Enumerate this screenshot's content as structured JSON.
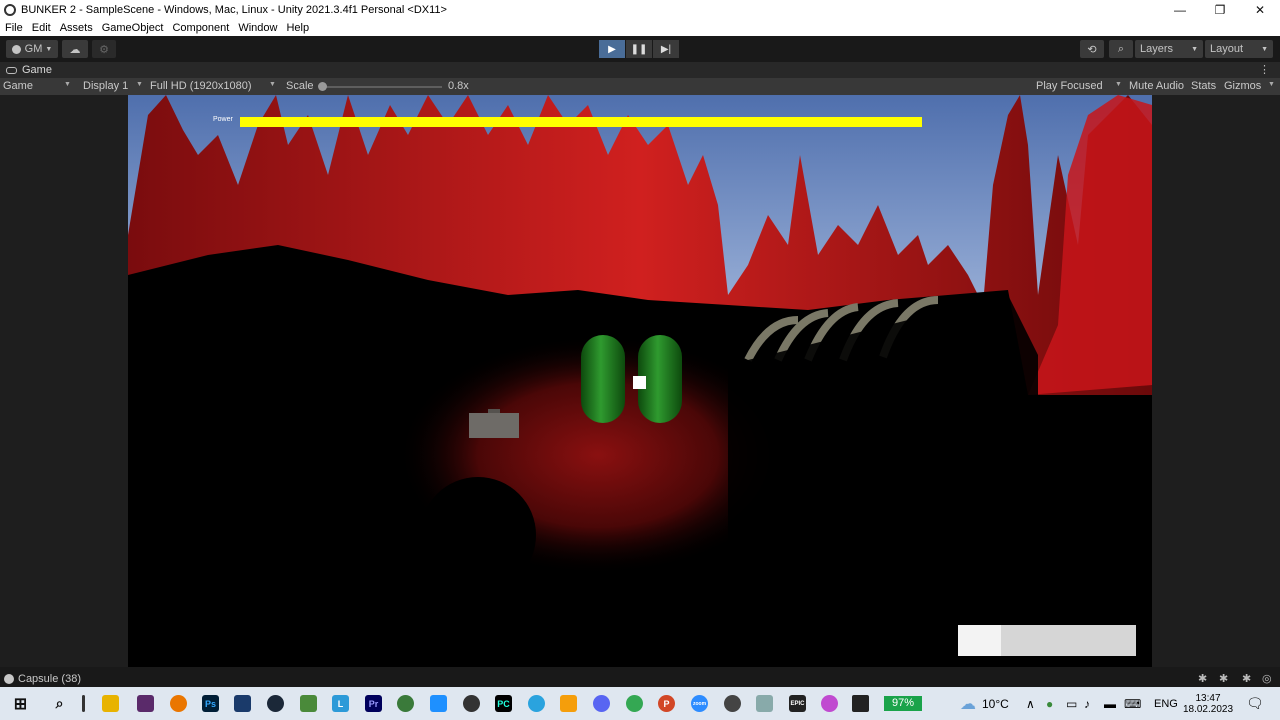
{
  "window": {
    "title": "BUNKER 2 - SampleScene - Windows, Mac, Linux - Unity 2021.3.4f1 Personal <DX11>",
    "minimize": "—",
    "maximize": "❐",
    "close": "✕"
  },
  "menu": [
    "File",
    "Edit",
    "Assets",
    "GameObject",
    "Component",
    "Window",
    "Help"
  ],
  "toolbar": {
    "account_label": "GM",
    "layers_label": "Layers",
    "layout_label": "Layout"
  },
  "game_tab": {
    "label": "Game"
  },
  "game_toolbar": {
    "view_mode": "Game",
    "display": "Display 1",
    "resolution": "Full HD (1920x1080)",
    "scale_label": "Scale",
    "scale_value": "0.8x",
    "play_focused": "Play Focused",
    "mute_audio": "Mute Audio",
    "stats": "Stats",
    "gizmos": "Gizmos"
  },
  "hud": {
    "power_label": "Power",
    "power_fraction": 1.0,
    "power_color": "#ffff00",
    "bottom_bar_fraction": 0.24
  },
  "status": {
    "text": "Capsule (38)"
  },
  "taskbar": {
    "battery": "97%",
    "weather": "10°C",
    "language": "ENG",
    "time": "13:47",
    "date": "18.02.2023"
  },
  "colors": {
    "editor_bg": "#191919",
    "play_active": "#4a6d98",
    "sky": "#6f8fc8",
    "rock_red": "#c0161a"
  }
}
